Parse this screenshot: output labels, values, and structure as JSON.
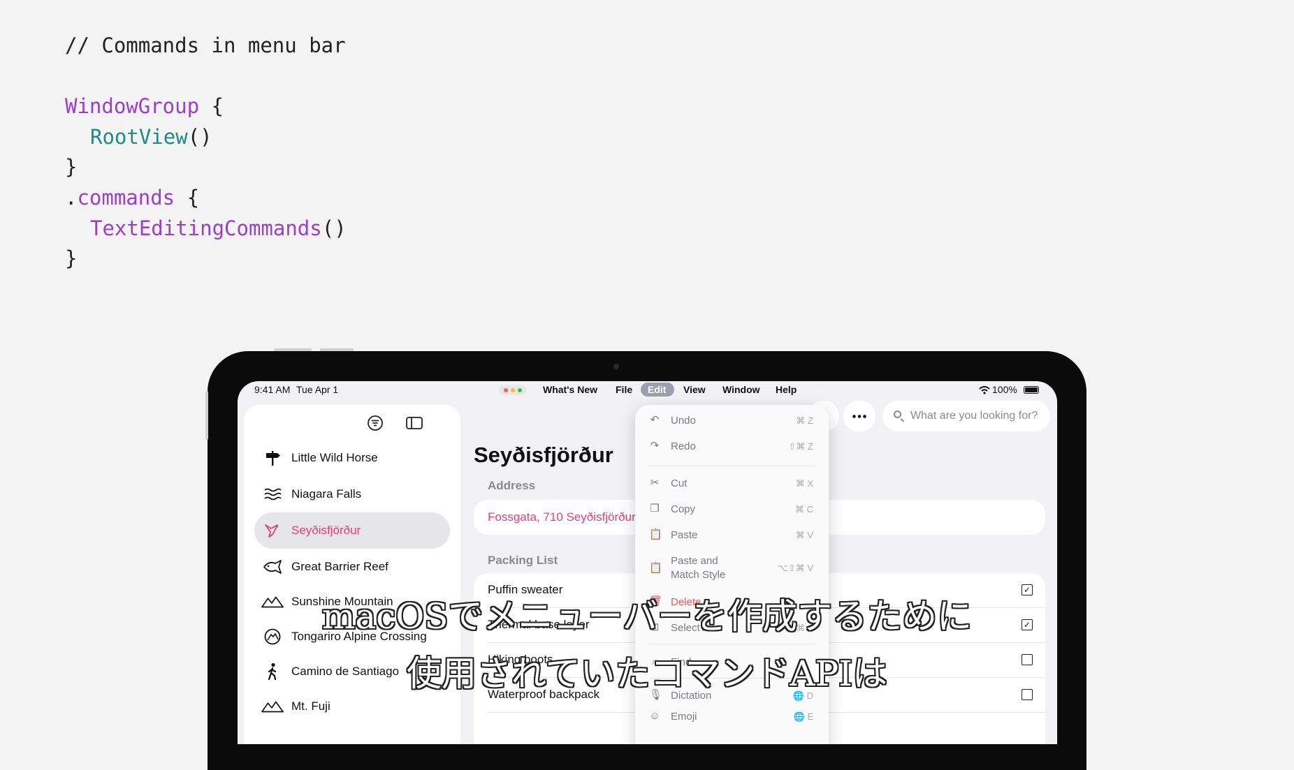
{
  "code": {
    "comment": "// Commands in menu bar",
    "window_group": "WindowGroup",
    "open_brace": " {",
    "root_view": "RootView",
    "parens": "()",
    "close_brace": "}",
    "dot": ".",
    "commands": "commands",
    "text_editing": "TextEditingCommands",
    "parens2": "()",
    "close_brace2": "}"
  },
  "status_bar": {
    "time": "9:41 AM",
    "date": "Tue Apr 1",
    "battery": "100%"
  },
  "menu_bar": {
    "items": [
      "What's New",
      "File",
      "Edit",
      "View",
      "Window",
      "Help"
    ]
  },
  "sidebar": {
    "items": [
      {
        "label": "Little Wild Horse",
        "icon": "signpost-icon"
      },
      {
        "label": "Niagara Falls",
        "icon": "water-waves-icon"
      },
      {
        "label": "Seyðisfjörður",
        "icon": "bird-icon",
        "selected": true
      },
      {
        "label": "Great Barrier Reef",
        "icon": "fish-icon"
      },
      {
        "label": "Sunshine Mountain",
        "icon": "mountain-icon"
      },
      {
        "label": "Tongariro Alpine Crossing",
        "icon": "volcano-icon"
      },
      {
        "label": "Camino de Santiago",
        "icon": "hiker-icon"
      },
      {
        "label": "Mt. Fuji",
        "icon": "mountain-icon"
      }
    ]
  },
  "detail": {
    "title": "Seyðisfjörður",
    "address_label": "Address",
    "address_value": "Fossgata, 710 Seyðisfjörður,",
    "packing_label": "Packing List",
    "packing": [
      {
        "name": "Puffin sweater",
        "checked": true
      },
      {
        "name": "Thermal base layer",
        "checked": true
      },
      {
        "name": "Hiking boots",
        "checked": false
      },
      {
        "name": "Waterproof backpack",
        "checked": false
      }
    ]
  },
  "search": {
    "placeholder": "What are you looking for?"
  },
  "edit_menu": {
    "undo": "Undo",
    "undo_sc": "⌘ Z",
    "redo": "Redo",
    "redo_sc": "⇧⌘ Z",
    "cut": "Cut",
    "cut_sc": "⌘ X",
    "copy": "Copy",
    "copy_sc": "⌘ C",
    "paste": "Paste",
    "paste_sc": "⌘ V",
    "paste_match_1": "Paste and",
    "paste_match_2": "Match Style",
    "paste_match_sc": "⌥⇧⌘ V",
    "delete": "Delete",
    "select_all": "Select All",
    "select_all_sc": "⌘ A",
    "find": "Find",
    "dictation": "Dictation",
    "dictation_sc": "🌐 D",
    "emoji": "Emoji",
    "emoji_sc": "🌐 E"
  },
  "subtitles": {
    "line1": "macOSでメニューバーを作成するために",
    "line2": "使用されていたコマンドAPIは"
  },
  "colors": {
    "accent": "#e0407a",
    "code_keyword": "#9a3fc7",
    "code_view": "#1f8a8a"
  }
}
